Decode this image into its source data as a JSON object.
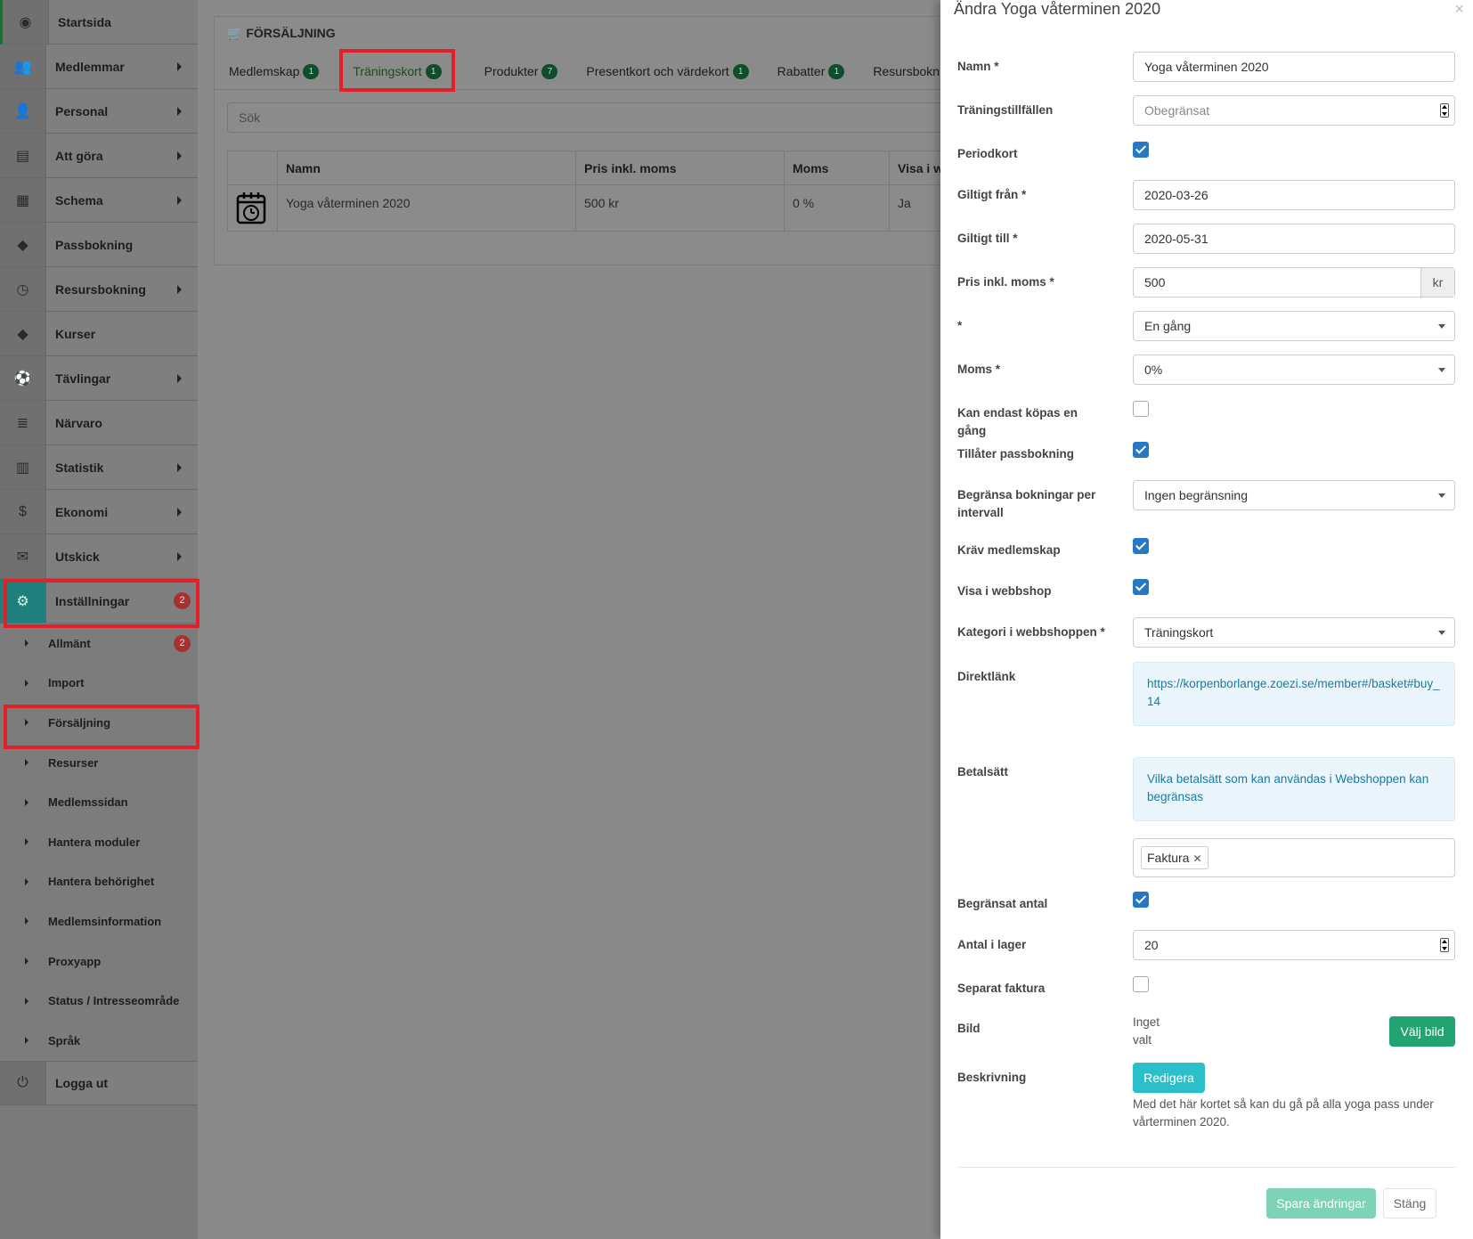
{
  "sidebar": {
    "items": [
      {
        "label": "Startsida",
        "icon": "dashboard-icon",
        "glyph": "◉",
        "caret": false
      },
      {
        "label": "Medlemmar",
        "icon": "users-icon",
        "glyph": "👥",
        "caret": true
      },
      {
        "label": "Personal",
        "icon": "user-icon",
        "glyph": "👤",
        "caret": true
      },
      {
        "label": "Att göra",
        "icon": "list-icon",
        "glyph": "▤",
        "caret": true
      },
      {
        "label": "Schema",
        "icon": "calendar-icon",
        "glyph": "▦",
        "caret": true
      },
      {
        "label": "Passbokning",
        "icon": "ticket-icon",
        "glyph": "◆",
        "caret": false
      },
      {
        "label": "Resursbokning",
        "icon": "clock-icon",
        "glyph": "◷",
        "caret": true
      },
      {
        "label": "Kurser",
        "icon": "ticket-icon",
        "glyph": "◆",
        "caret": false
      },
      {
        "label": "Tävlingar",
        "icon": "ball-icon",
        "glyph": "⚽",
        "caret": true
      },
      {
        "label": "Närvaro",
        "icon": "lines-icon",
        "glyph": "≣",
        "caret": false
      },
      {
        "label": "Statistik",
        "icon": "bar-chart-icon",
        "glyph": "▥",
        "caret": true
      },
      {
        "label": "Ekonomi",
        "icon": "dollar-icon",
        "glyph": "$",
        "caret": true
      },
      {
        "label": "Utskick",
        "icon": "envelope-icon",
        "glyph": "✉",
        "caret": true
      }
    ],
    "settings": {
      "label": "Inställningar",
      "icon": "gear-icon",
      "glyph": "⚙",
      "badge": "2"
    },
    "subitems": [
      {
        "label": "Allmänt",
        "badge": "2"
      },
      {
        "label": "Import"
      },
      {
        "label": "Försäljning"
      },
      {
        "label": "Resurser"
      },
      {
        "label": "Medlemssidan"
      },
      {
        "label": "Hantera moduler"
      },
      {
        "label": "Hantera behörighet"
      },
      {
        "label": "Medlemsinformation"
      },
      {
        "label": "Proxyapp"
      },
      {
        "label": "Status / Intresseområde"
      },
      {
        "label": "Språk"
      }
    ],
    "logout": {
      "label": "Logga ut",
      "icon": "power-icon",
      "glyph": "⏻"
    }
  },
  "main": {
    "title": "FÖRSÄLJNING",
    "tabs": [
      {
        "label": "Medlemskap",
        "count": "1"
      },
      {
        "label": "Träningskort",
        "count": "1",
        "active": true
      },
      {
        "label": "Produkter",
        "count": "7"
      },
      {
        "label": "Presentkort och värdekort",
        "count": "1"
      },
      {
        "label": "Rabatter",
        "count": "1"
      },
      {
        "label": "Resursbokni",
        "count": ""
      }
    ],
    "search_placeholder": "Sök",
    "table": {
      "headers": [
        "",
        "Namn",
        "Pris inkl. moms",
        "Moms",
        "Visa i w"
      ],
      "rows": [
        [
          "",
          "Yoga våterminen 2020",
          "500 kr",
          "0 %",
          "Ja"
        ]
      ]
    }
  },
  "modal": {
    "title": "Ändra Yoga våterminen 2020",
    "close": "×",
    "fields": {
      "namn_label": "Namn *",
      "namn_value": "Yoga våterminen 2020",
      "tillfallen_label": "Träningstillfällen",
      "tillfallen_placeholder": "Obegränsat",
      "periodkort_label": "Periodkort",
      "fran_label": "Giltigt från *",
      "fran_value": "2020-03-26",
      "till_label": "Giltigt till *",
      "till_value": "2020-05-31",
      "pris_label": "Pris inkl. moms *",
      "pris_value": "500",
      "pris_unit": "kr",
      "star_label": "*",
      "star_value": "En gång",
      "moms_label": "Moms *",
      "moms_value": "0%",
      "enGang_label": "Kan endast köpas en gång",
      "passbokning_label": "Tillåter passbokning",
      "begransa_label": "Begränsa bokningar per intervall",
      "begransa_value": "Ingen begränsning",
      "medlemskap_label": "Kräv medlemskap",
      "webbshop_label": "Visa i webbshop",
      "kategori_label": "Kategori i webbshoppen *",
      "kategori_value": "Träningskort",
      "direktlank_label": "Direktlänk",
      "direktlank_value": "https://korpenborlange.zoezi.se/member#/basket#buy_14",
      "betalsatt_label": "Betalsätt",
      "betalsatt_info": "Vilka betalsätt som kan användas i Webshoppen kan begränsas",
      "betalsatt_tag": "Faktura",
      "begransat_label": "Begränsat antal",
      "lager_label": "Antal i lager",
      "lager_value": "20",
      "separat_label": "Separat faktura",
      "bild_label": "Bild",
      "bild_value": "Inget valt",
      "bild_button": "Välj bild",
      "beskrivning_label": "Beskrivning",
      "beskrivning_button": "Redigera",
      "beskrivning_text": "Med det här kortet så kan du gå på alla yoga pass under vårterminen 2020."
    },
    "save": "Spara ändringar",
    "cancel": "Stäng"
  },
  "colors": {
    "accent": "#2778c4",
    "success": "#21b07a",
    "info": "#2bc0c9",
    "highlight": "#e3202a"
  }
}
